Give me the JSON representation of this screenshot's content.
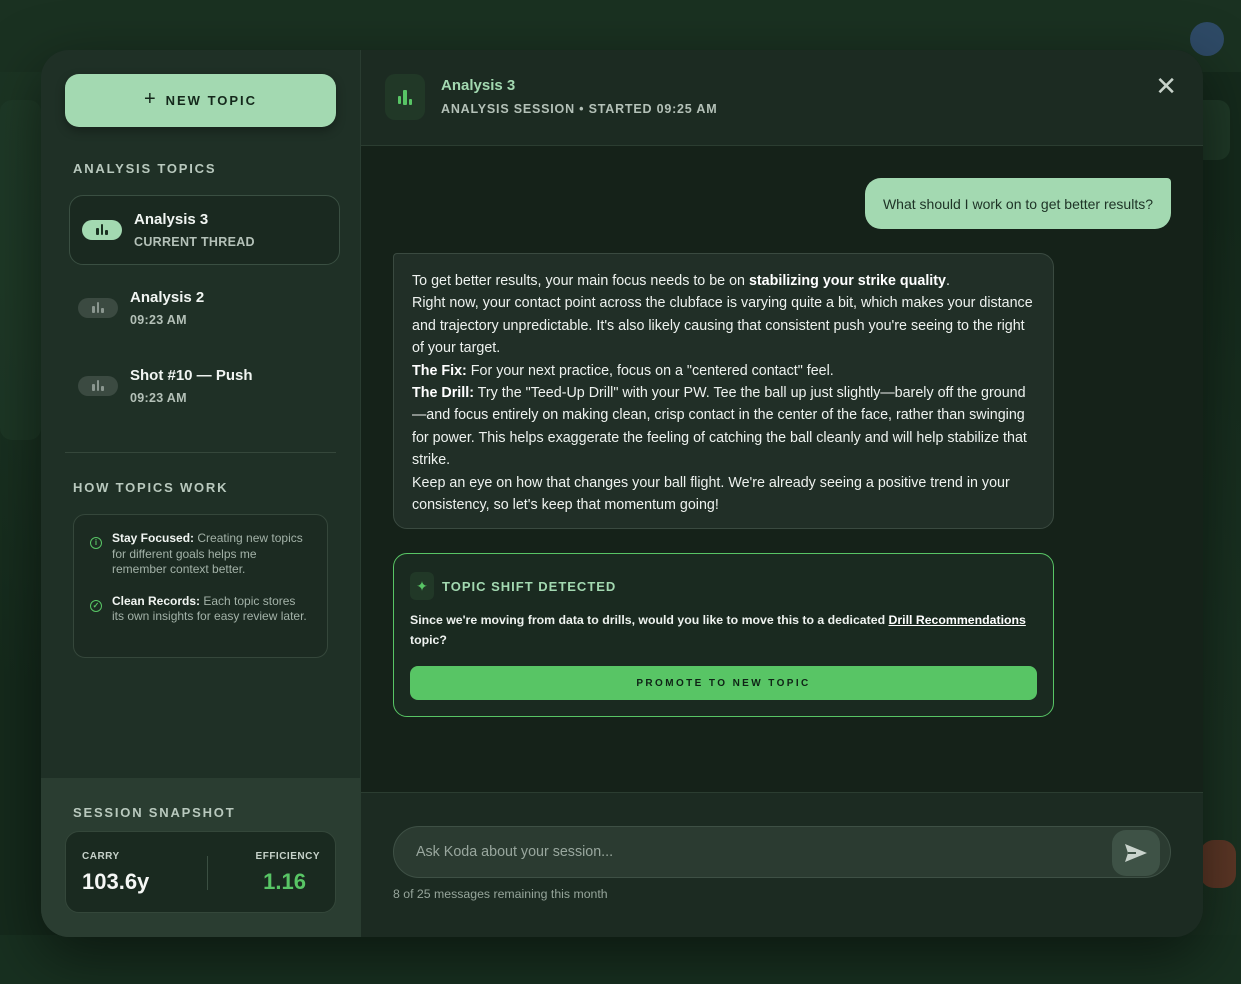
{
  "sidebar": {
    "new_topic_label": "NEW TOPIC",
    "topics_heading": "ANALYSIS TOPICS",
    "topics": [
      {
        "name": "Analysis 3",
        "sub": "CURRENT THREAD"
      },
      {
        "name": "Analysis 2",
        "sub": "09:23 AM"
      },
      {
        "name": "Shot #10 — Push",
        "sub": "09:23 AM"
      }
    ],
    "how_heading": "HOW TOPICS WORK",
    "how_items": [
      {
        "title": "Stay Focused:",
        "text": " Creating new topics for different goals helps me remember context better."
      },
      {
        "title": "Clean Records:",
        "text": " Each topic stores its own insights for easy review later."
      }
    ],
    "snapshot": {
      "heading": "SESSION SNAPSHOT",
      "carry_label": "CARRY",
      "carry_value": "103.6y",
      "efficiency_label": "EFFICIENCY",
      "efficiency_value": "1.16"
    }
  },
  "header": {
    "title": "Analysis 3",
    "subtitle": "ANALYSIS SESSION • STARTED 09:25 AM"
  },
  "messages": {
    "user": "What should I work on to get better results?",
    "ai": {
      "p1_pre": "To get better results, your main focus needs to be on ",
      "p1_bold": "stabilizing your strike quality",
      "p1_post": ".",
      "p2": "Right now, your contact point across the clubface is varying quite a bit, which makes your distance and trajectory unpredictable. It's also likely causing that consistent push you're seeing to the right of your target.",
      "fix_label": "The Fix:",
      "fix_text": " For your next practice, focus on a \"centered contact\" feel.",
      "drill_label": "The Drill:",
      "drill_text": " Try the \"Teed-Up Drill\" with your PW. Tee the ball up just slightly—barely off the ground—and focus entirely on making clean, crisp contact in the center of the face, rather than swinging for power. This helps exaggerate the feeling of catching the ball cleanly and will help stabilize that strike.",
      "closing": "Keep an eye on how that changes your ball flight. We're already seeing a positive trend in your consistency, so let's keep that momentum going!"
    }
  },
  "topic_shift": {
    "title": "TOPIC SHIFT DETECTED",
    "text_pre": "Since we're moving from data to drills, would you like to move this to a dedicated ",
    "text_link": "Drill Recommendations",
    "text_post": " topic?",
    "button": "PROMOTE TO NEW TOPIC"
  },
  "composer": {
    "placeholder": "Ask Koda about your session...",
    "remaining": "8 of 25 messages remaining this month"
  },
  "colors": {
    "accent": "#a3d9b1",
    "green": "#58c565"
  }
}
